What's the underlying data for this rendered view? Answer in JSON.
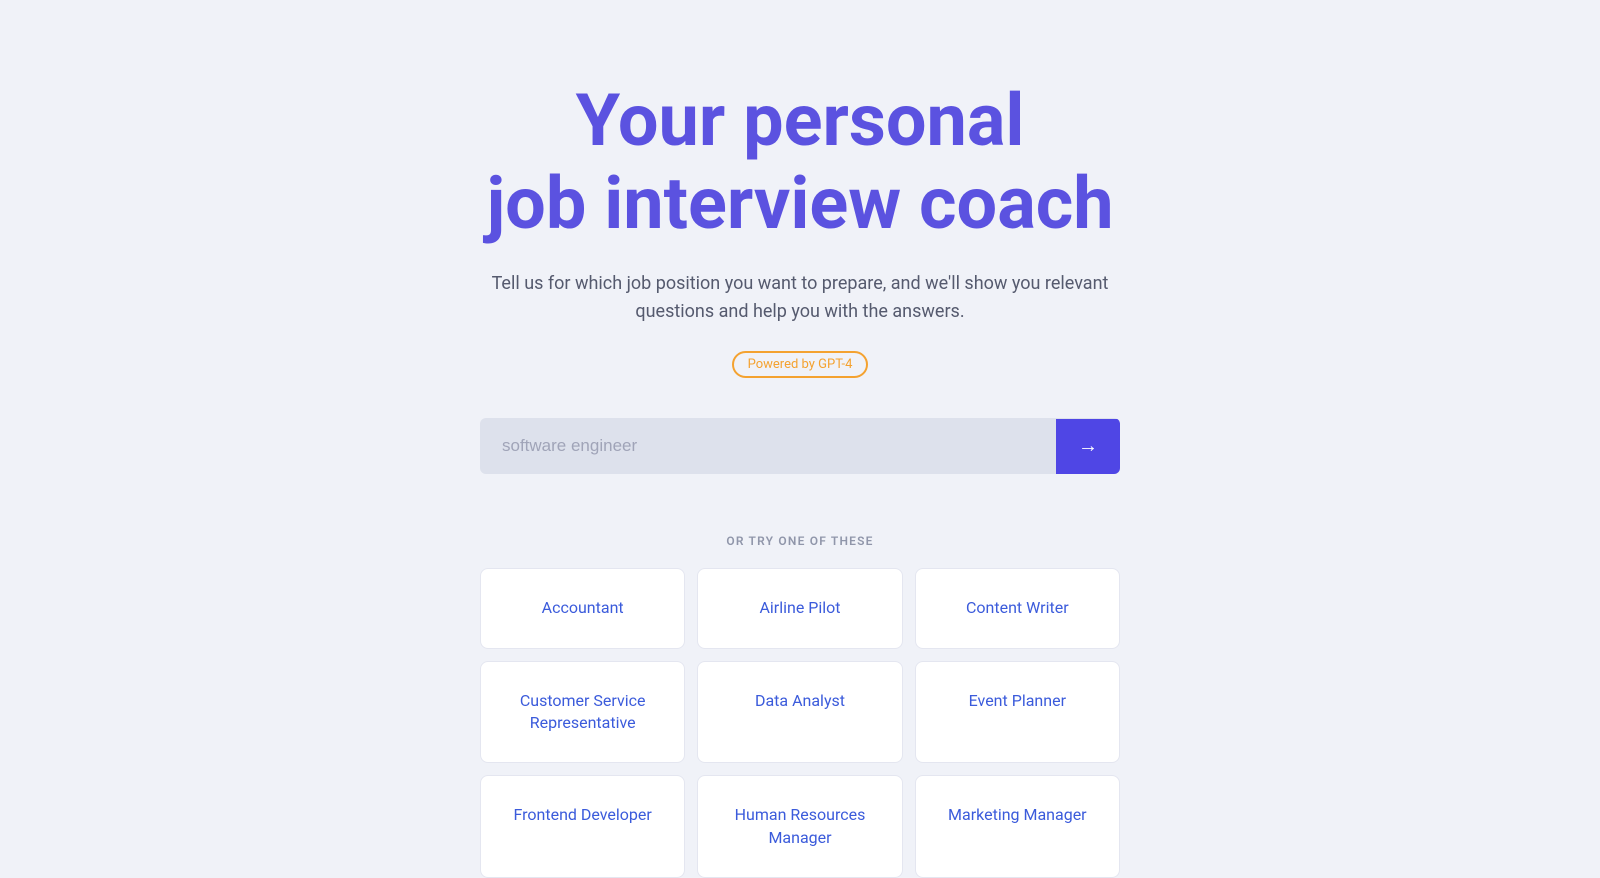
{
  "hero": {
    "title_line1": "Your personal",
    "title_line2": "job interview coach",
    "subtitle": "Tell us for which job position you want to prepare, and we'll show you relevant questions and help you with the answers.",
    "badge": "Powered by GPT-4"
  },
  "search": {
    "placeholder": "software engineer",
    "button_label": "→"
  },
  "suggestions": {
    "label": "OR TRY ONE OF THESE",
    "items": [
      {
        "label": "Accountant"
      },
      {
        "label": "Airline Pilot"
      },
      {
        "label": "Content Writer"
      },
      {
        "label": "Customer Service Representative"
      },
      {
        "label": "Data Analyst"
      },
      {
        "label": "Event Planner"
      },
      {
        "label": "Frontend Developer"
      },
      {
        "label": "Human Resources Manager"
      },
      {
        "label": "Marketing Manager"
      }
    ]
  }
}
